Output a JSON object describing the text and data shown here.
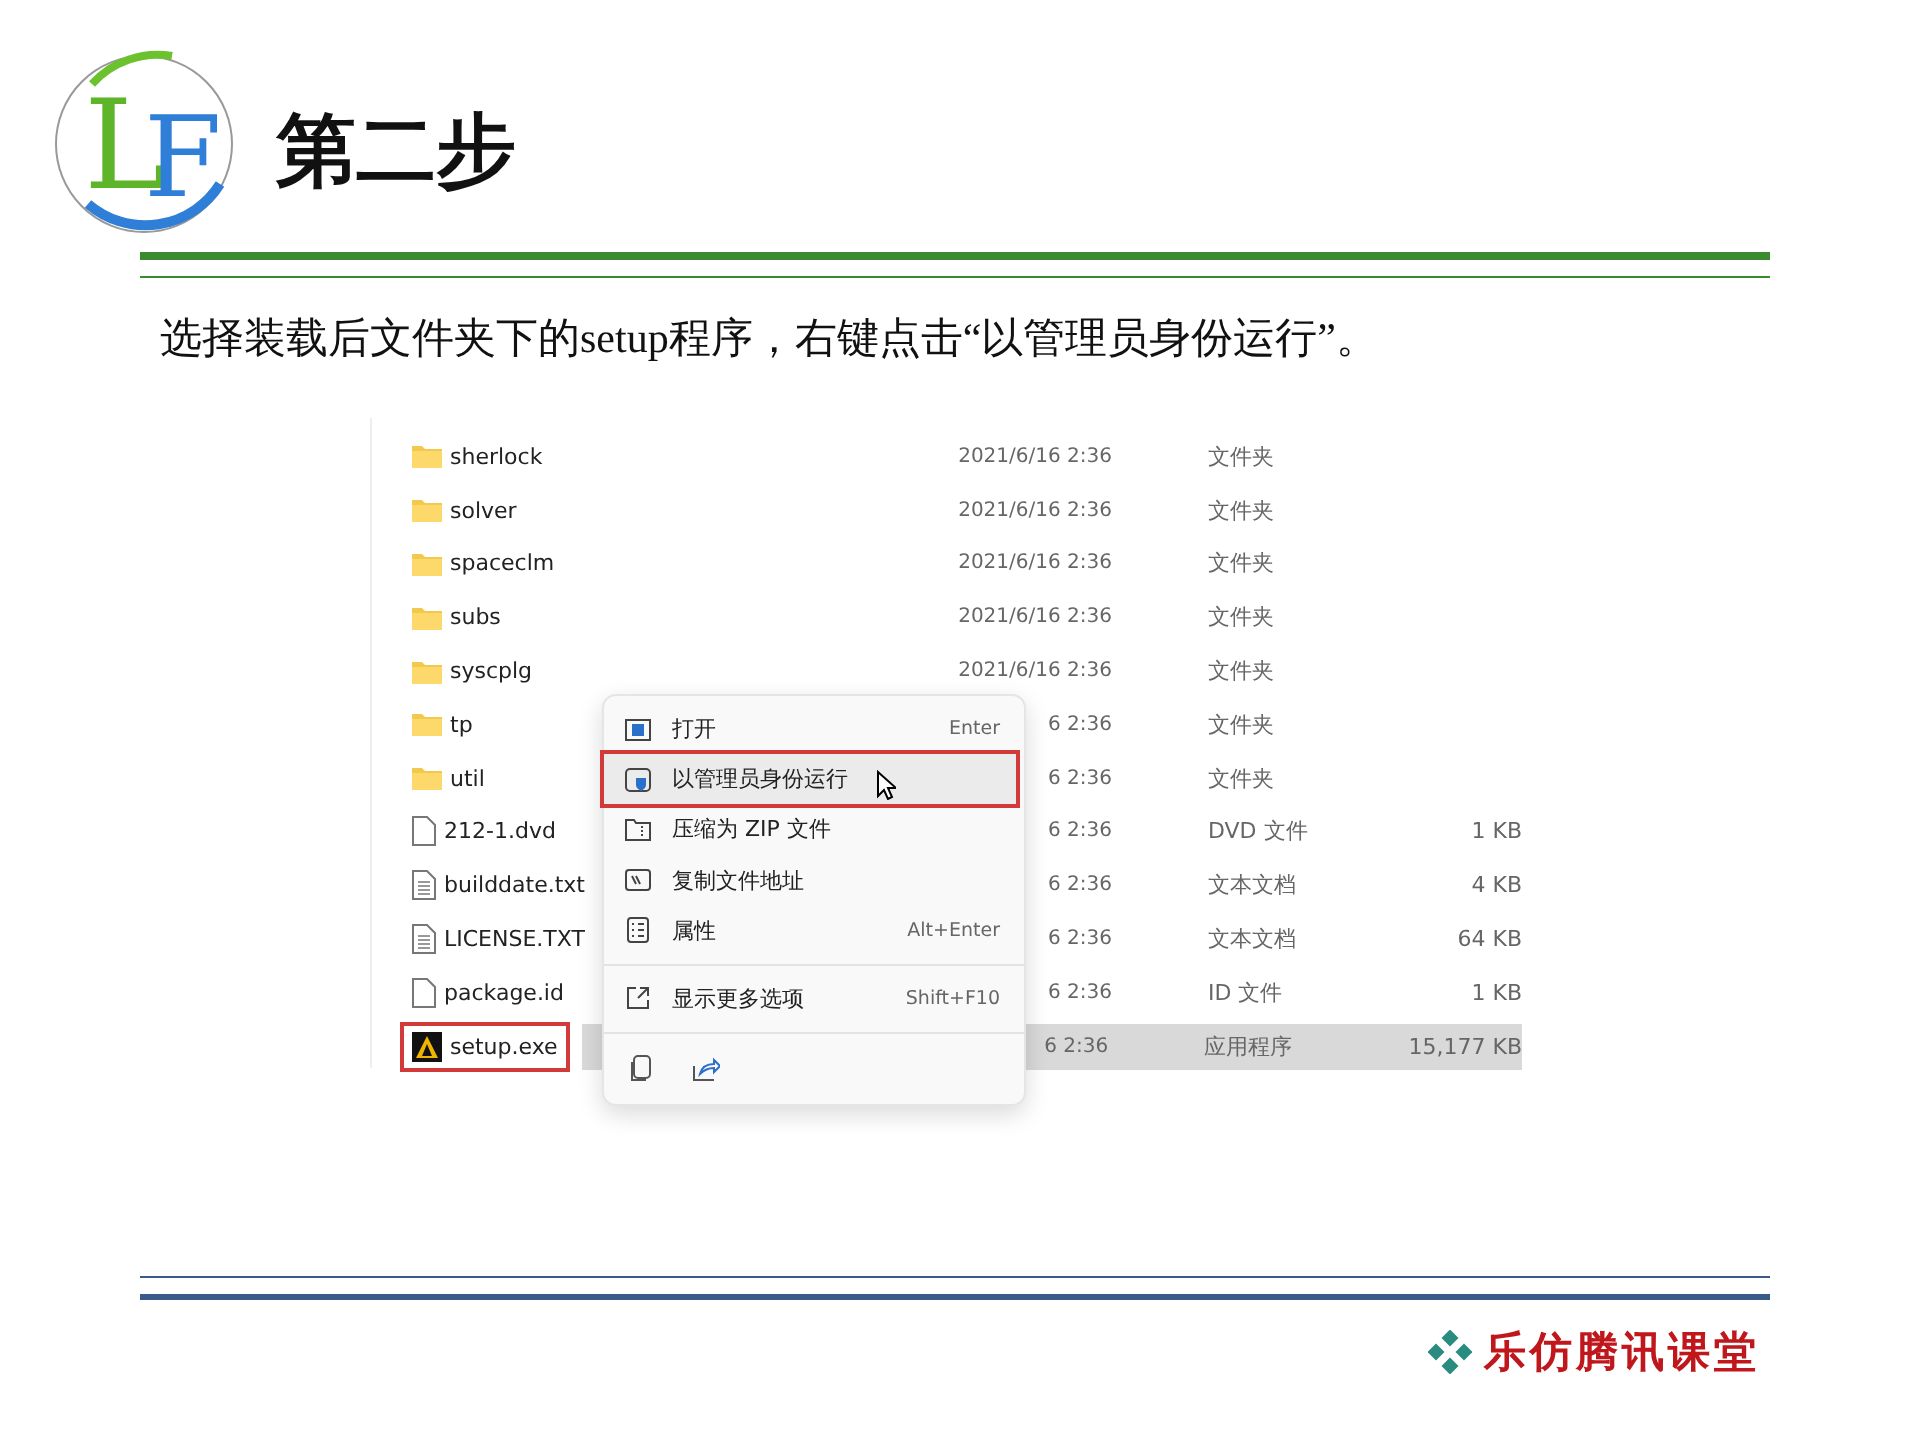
{
  "logo": {
    "letters": [
      "L",
      "F"
    ]
  },
  "title": "第二步",
  "instruction": "选择装载后文件夹下的setup程序，右键点击“以管理员身份运行”。",
  "files": [
    {
      "kind": "folder",
      "name": "sherlock",
      "date": "2021/6/16 2:36",
      "type": "文件夹",
      "selected": false,
      "highlighted": false
    },
    {
      "kind": "folder",
      "name": "solver",
      "date": "2021/6/16 2:36",
      "type": "文件夹",
      "selected": false,
      "highlighted": false
    },
    {
      "kind": "folder",
      "name": "spaceclm",
      "date": "2021/6/16 2:36",
      "type": "文件夹",
      "selected": false,
      "highlighted": false
    },
    {
      "kind": "folder",
      "name": "subs",
      "date": "2021/6/16 2:36",
      "type": "文件夹",
      "selected": false,
      "highlighted": false
    },
    {
      "kind": "folder",
      "name": "syscplg",
      "date": "2021/6/16 2:36",
      "type": "文件夹",
      "selected": false,
      "highlighted": false
    },
    {
      "kind": "folder",
      "name": "tp",
      "date": "6 2:36",
      "type": "文件夹",
      "selected": false,
      "highlighted": false
    },
    {
      "kind": "folder",
      "name": "util",
      "date": "6 2:36",
      "type": "文件夹",
      "selected": false,
      "highlighted": false
    },
    {
      "kind": "file",
      "name": "212-1.dvd",
      "date": "6 2:36",
      "type": "DVD 文件",
      "size": "1 KB",
      "selected": false,
      "highlighted": false
    },
    {
      "kind": "text",
      "name": "builddate.txt",
      "date": "6 2:36",
      "type": "文本文档",
      "size": "4 KB",
      "selected": false,
      "highlighted": false
    },
    {
      "kind": "text",
      "name": "LICENSE.TXT",
      "date": "6 2:36",
      "type": "文本文档",
      "size": "64 KB",
      "selected": false,
      "highlighted": false
    },
    {
      "kind": "file",
      "name": "package.id",
      "date": "6 2:36",
      "type": "ID 文件",
      "size": "1 KB",
      "selected": false,
      "highlighted": false
    },
    {
      "kind": "app",
      "name": "setup.exe",
      "date": "6 2:36",
      "type": "应用程序",
      "size": "15,177 KB",
      "selected": true,
      "highlighted": true
    }
  ],
  "context_menu": {
    "items": [
      {
        "kind": "open",
        "label": "打开",
        "shortcut": "Enter",
        "hovered": false,
        "highlighted": false
      },
      {
        "kind": "admin",
        "label": "以管理员身份运行",
        "hovered": true,
        "highlighted": true
      },
      {
        "kind": "zip",
        "label": "压缩为 ZIP 文件",
        "hovered": false,
        "highlighted": false
      },
      {
        "kind": "path",
        "label": "复制文件地址",
        "hovered": false,
        "highlighted": false
      },
      {
        "kind": "props",
        "label": "属性",
        "shortcut": "Alt+Enter",
        "hovered": false,
        "highlighted": false
      },
      {
        "kind": "more",
        "label": "显示更多选项",
        "shortcut": "Shift+F10",
        "hovered": false,
        "highlighted": false,
        "separator_before": true
      }
    ]
  },
  "footer": {
    "brand": "乐仿腾讯课堂"
  }
}
